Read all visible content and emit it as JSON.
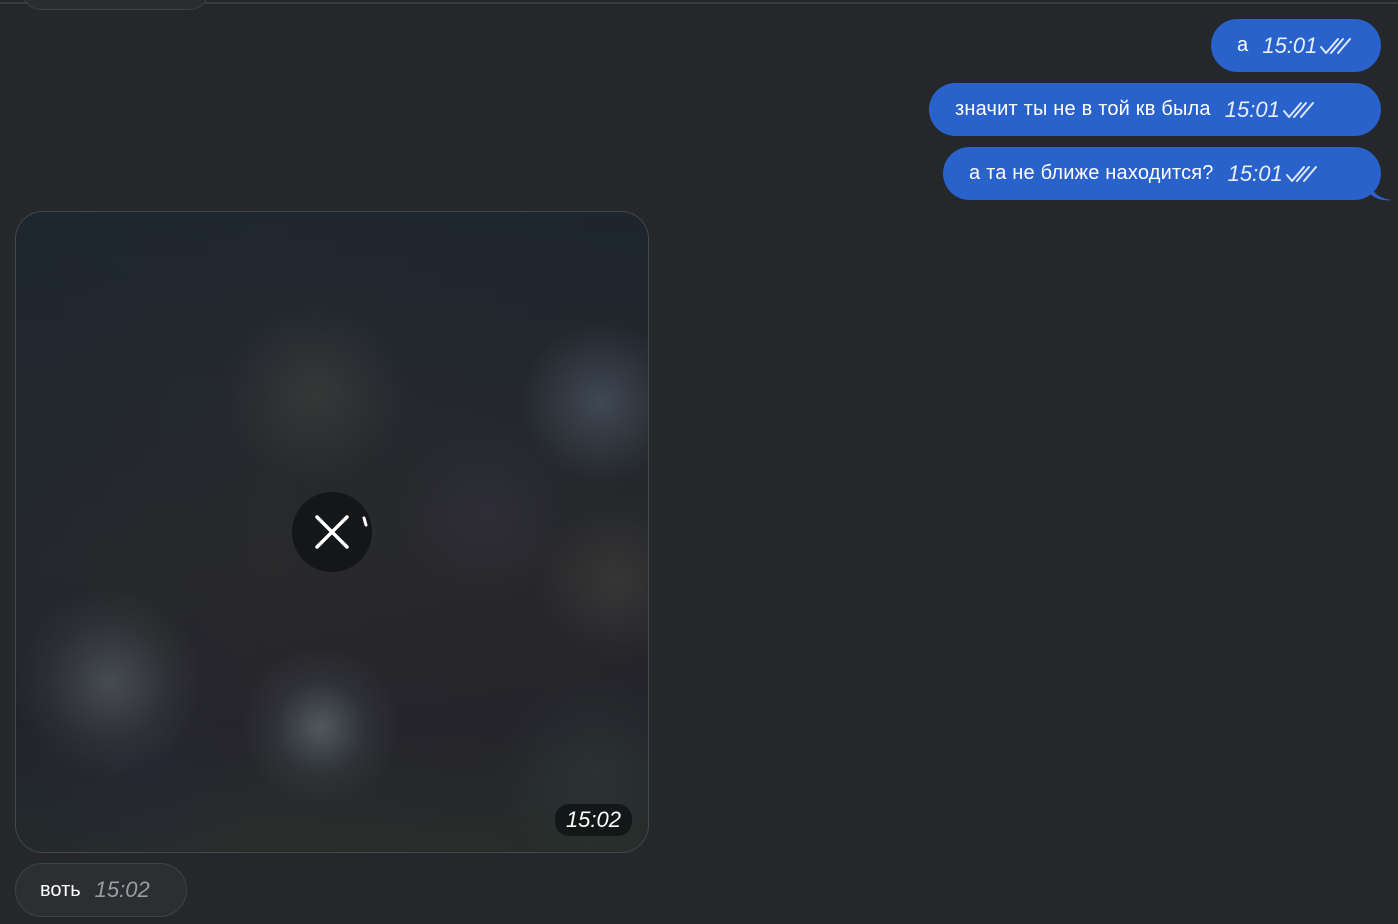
{
  "messages": {
    "outgoing": [
      {
        "text": "а",
        "time": "15:01",
        "status": "read"
      },
      {
        "text": "значит ты не в той кв была",
        "time": "15:01",
        "status": "read"
      },
      {
        "text": "а та не ближе находится?",
        "time": "15:01",
        "status": "read"
      }
    ],
    "photo": {
      "time": "15:02",
      "state": "uploading"
    },
    "incoming": [
      {
        "text": "воть",
        "time": "15:02"
      }
    ]
  },
  "colors": {
    "background": "#25272a",
    "outgoing_bubble": "#2a62cc",
    "incoming_bubble": "#2c2e31"
  },
  "icons": {
    "read_status": "double-check-icon",
    "cancel_upload": "close-icon",
    "progress": "spinner-icon"
  }
}
